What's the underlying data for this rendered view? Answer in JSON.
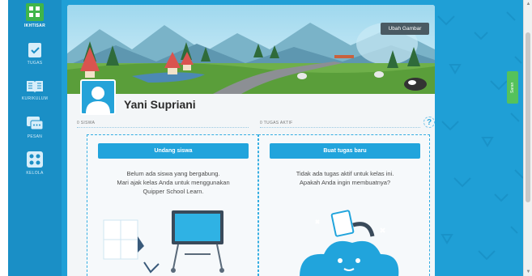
{
  "sidebar": {
    "items": [
      {
        "label": "IKHTISAR",
        "icon": "grid-icon",
        "active": true
      },
      {
        "label": "TUGAS",
        "icon": "assignment-icon",
        "active": false
      },
      {
        "label": "KURIKULUM",
        "icon": "book-icon",
        "active": false
      },
      {
        "label": "PESAN",
        "icon": "message-icon",
        "active": false
      },
      {
        "label": "KELOLA",
        "icon": "manage-icon",
        "active": false
      }
    ]
  },
  "banner": {
    "change_picture_label": "Ubah Gambar"
  },
  "class": {
    "name": "Yani Supriani"
  },
  "students": {
    "count_label": "0 SISWA",
    "button_label": "Undang siswa",
    "empty_text_1": "Belum ada siswa yang bergabung.",
    "empty_text_2": "Mari ajak kelas Anda untuk menggunakan",
    "empty_text_3": "Quipper School Learn."
  },
  "tasks": {
    "count_label": "0 TUGAS AKTIF",
    "button_label": "Buat tugas baru",
    "empty_text_1": "Tidak ada tugas aktif untuk kelas ini.",
    "empty_text_2": "Apakah Anda ingin membuatnya?"
  },
  "help_label": "?",
  "feedback_tab": "Saran",
  "colors": {
    "background_blue": "#1f9fd6",
    "sidebar_blue": "#1a8fc6",
    "button_blue": "#21a4dc",
    "feedback_green": "#55c25b",
    "sidebar_active_green": "#3fb54a"
  }
}
